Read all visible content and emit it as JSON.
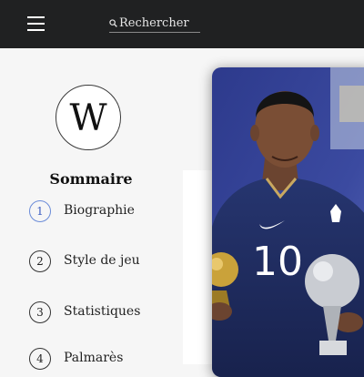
{
  "header": {
    "menu_icon": "hamburger-menu-icon",
    "search_icon": "search-icon",
    "search_placeholder": "Rechercher"
  },
  "sidebar": {
    "logo_icon": "wikipedia-w-icon",
    "logo_letter": "W",
    "toc_title": "Sommaire",
    "toc_items": [
      {
        "num": "1",
        "label": "Biographie",
        "active": true
      },
      {
        "num": "2",
        "label": "Style de jeu"
      },
      {
        "num": "3",
        "label": "Statistiques"
      },
      {
        "num": "4",
        "label": "Palmarès"
      }
    ]
  },
  "hero_image": {
    "jersey_number": "10"
  },
  "colors": {
    "topbar": "#202122",
    "page_bg": "#f6f6f6",
    "active_toc": "#6a8bd8",
    "jersey": "#1f2f66"
  }
}
